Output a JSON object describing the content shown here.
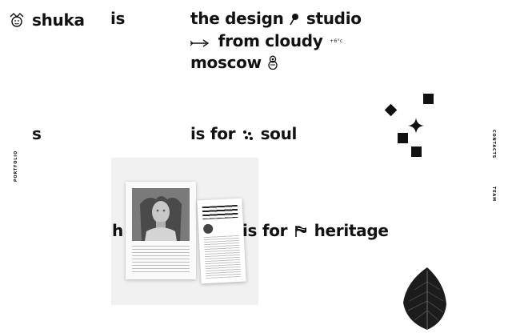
{
  "brand": {
    "name": "shuka",
    "logo_icon": "jester-face-icon"
  },
  "hero": {
    "is_word": "is",
    "line1": "the design",
    "line2": "studio",
    "line3": "from cloudy",
    "temperature": "+6°c",
    "line4": "moscow"
  },
  "rows": [
    {
      "letter": "s",
      "prefix": "is for",
      "word": "soul"
    },
    {
      "letter": "h",
      "prefix": "is for",
      "word": "heritage"
    }
  ],
  "side_nav": {
    "left": "portfolio",
    "right_top": "contacts",
    "right_bottom": "team"
  },
  "colors": {
    "text": "#111111",
    "background": "#ffffff"
  }
}
